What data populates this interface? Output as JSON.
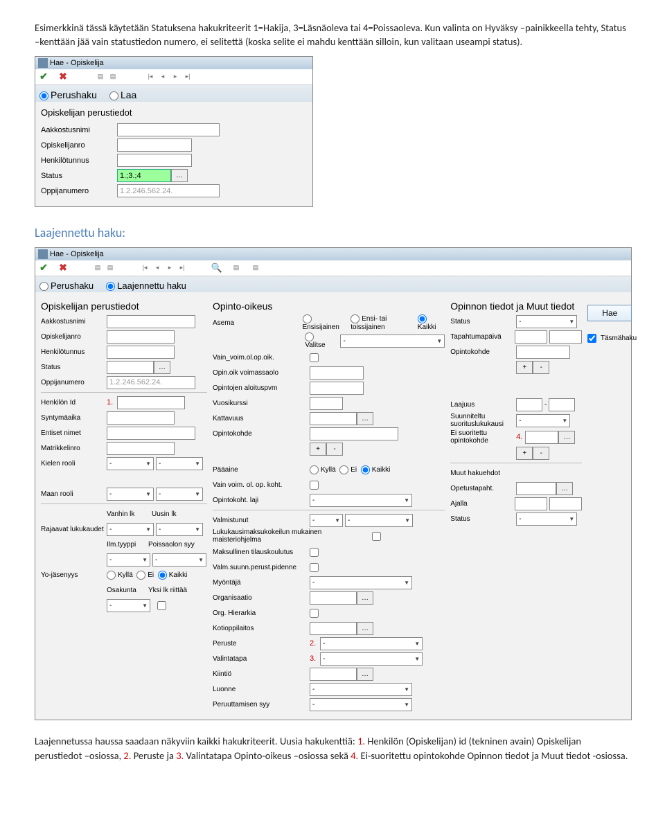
{
  "intro": {
    "p1": "Esimerkkinä tässä käytetään Statuksena hakukriteerit 1=Hakija, 3=Läsnäoleva tai 4=Poissaoleva. Kun valinta on Hyväksy –painikkeella tehty, Status –kenttään jää vain statustiedon numero, ei selitettä (koska selite ei mahdu kenttään silloin, kun valitaan useampi status)."
  },
  "win1": {
    "title": "Hae - Opiskelija",
    "tab_perus": "Perushaku",
    "tab_laaj_cut": "Laa",
    "panel": "Opiskelijan perustiedot",
    "f_aakkostus": "Aakkostusnimi",
    "f_opnro": "Opiskelijanro",
    "f_hetu": "Henkilötunnus",
    "f_status": "Status",
    "f_oppija": "Oppijanumero",
    "status_val": "1.;3.;4",
    "oppija_ph": "1.2.246.562.24."
  },
  "heading_laaj": "Laajennettu haku:",
  "win2": {
    "title": "Hae - Opiskelija",
    "tab_perus": "Perushaku",
    "tab_laaj": "Laajennettu haku",
    "col1_title": "Opiskelijan perustiedot",
    "col2_title": "Opinto-oikeus",
    "col3_title": "Opinnon tiedot ja Muut tiedot",
    "btn_hae": "Hae",
    "chk_tasma": "Täsmähaku",
    "f_aakkostus": "Aakkostusnimi",
    "f_opnro": "Opiskelijanro",
    "f_hetu": "Henkilötunnus",
    "f_status": "Status",
    "f_oppija": "Oppijanumero",
    "oppija_ph": "1.2.246.562.24.",
    "f_henkid": "Henkilön Id",
    "f_synt": "Syntymäaika",
    "f_entnimet": "Entiset nimet",
    "f_matrik": "Matrikkelinro",
    "f_kieliro": "Kielen rooli",
    "f_maanro": "Maan rooli",
    "f_vanhinlk": "Vanhin lk",
    "f_uusinlk": "Uusin lk",
    "f_rajlk": "Rajaavat lukukaudet",
    "f_ilmtyyppi": "Ilm.tyyppi",
    "f_poisssyy": "Poissaolon syy",
    "f_yoj": "Yo-jäsenyys",
    "f_osak": "Osakunta",
    "f_yksilk": "Yksi lk riittää",
    "r_kylla": "Kyllä",
    "r_ei": "Ei",
    "r_kaikki": "Kaikki",
    "f_asema": "Asema",
    "r_ensis": "Ensisijainen",
    "r_ensitoi": "Ensi- tai toissijainen",
    "dd_valitse": "Valitse",
    "f_vainvoim": "Vain_voim.ol.op.oik.",
    "f_opvoim": "Opin.oik voimassaolo",
    "f_aloitus": "Opintojen aloituspvm",
    "f_vuosik": "Vuosikurssi",
    "f_katt": "Kattavuus",
    "f_opkohde": "Opintokohde",
    "f_paa": "Pääaine",
    "f_vainvoimol": "Vain voim. ol. op. koht.",
    "f_oplaji": "Opintokoht. laji",
    "f_valm": "Valmistunut",
    "f_lkmaisteri": "Lukukausimaksukokeilun mukainen maisteriohjelma",
    "f_maksul": "Maksullinen tilauskoulutus",
    "f_vpid": "Valm.suunn.perust.pidenne",
    "f_myont": "Myöntäjä",
    "f_org": "Organisaatio",
    "f_orgh": "Org. Hierarkia",
    "f_kotiopp": "Kotioppilaitos",
    "f_peruste": "Peruste",
    "f_valtapa": "Valintatapa",
    "f_kiintio": "Kiintiö",
    "f_luonne": "Luonne",
    "f_persyy": "Peruuttamisen syy",
    "f_status3": "Status",
    "f_tappvm": "Tapahtumapäivä",
    "f_opkohde3": "Opintokohde",
    "f_laaj": "Laajuus",
    "f_suunslk": "Suunniteltu suorituslukukausi",
    "f_eisuor": "Ei suoritettu opintokohde",
    "f_muut": "Muut hakuehdot",
    "f_optap": "Opetustapaht.",
    "f_ajalla": "Ajalla",
    "f_status4": "Status",
    "a1": "1.",
    "a2": "2.",
    "a3": "3.",
    "a4": "4."
  },
  "outro": {
    "p1a": "Laajennetussa haussa saadaan näkyviin kaikki hakukriteerit. Uusia hakukenttiä: ",
    "p1_1": "1.",
    "p1b": " Henkilön (Opiskelijan) id (tekninen avain) Opiskelijan perustiedot –osiossa, ",
    "p1_2": "2.",
    "p1c": " Peruste ja ",
    "p1_3": "3.",
    "p1d": " Valintatapa Opinto-oikeus –osiossa sekä ",
    "p1_4": "4.",
    "p1e": " Ei-suoritettu opintokohde Opinnon tiedot ja Muut tiedot -osiossa."
  }
}
